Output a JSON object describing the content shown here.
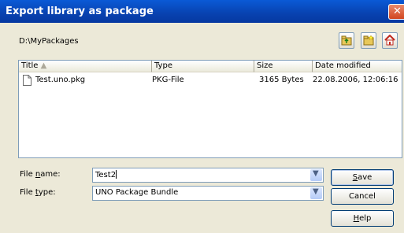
{
  "window": {
    "title": "Export library as package"
  },
  "path": "D:\\MyPackages",
  "toolbar": {
    "icons": [
      "up-folder-icon",
      "new-folder-icon",
      "home-icon"
    ]
  },
  "list": {
    "columns": [
      "Title",
      "Type",
      "Size",
      "Date modified"
    ],
    "rows": [
      {
        "title": "Test.uno.pkg",
        "type": "PKG-File",
        "size": "3165 Bytes",
        "date": "22.08.2006, 12:06:16"
      }
    ]
  },
  "file_name": {
    "label_pre": "File ",
    "label_u": "n",
    "label_post": "ame:",
    "value": "Test2"
  },
  "file_type": {
    "label_pre": "File ",
    "label_u": "t",
    "label_post": "ype:",
    "value": "UNO Package Bundle"
  },
  "buttons": {
    "save": {
      "u": "S",
      "rest": "ave"
    },
    "cancel": "Cancel",
    "help": {
      "u": "H",
      "rest": "elp"
    }
  }
}
